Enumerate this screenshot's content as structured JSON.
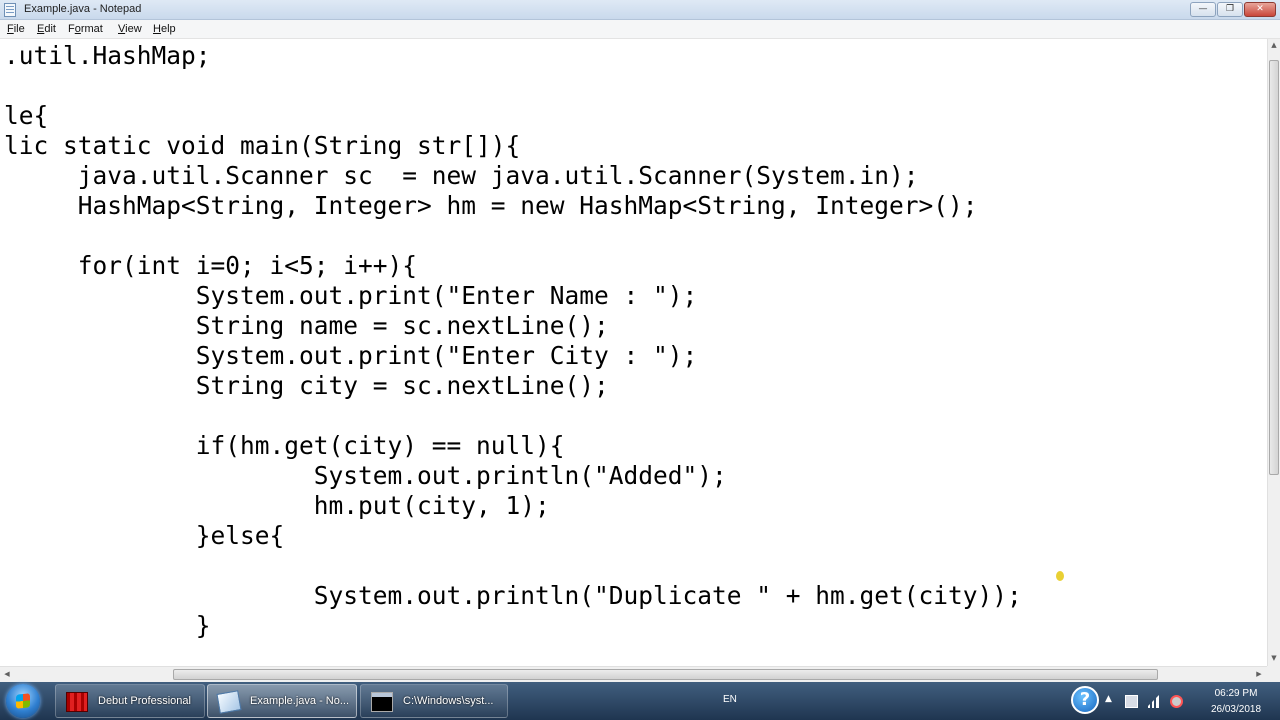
{
  "window": {
    "title": "Example.java - Notepad",
    "controls": {
      "minimize": "—",
      "maximize": "❐",
      "close": "✕"
    }
  },
  "menu": [
    {
      "label": "File",
      "access": "F",
      "rest": "ile"
    },
    {
      "label": "Edit",
      "access": "E",
      "rest": "dit"
    },
    {
      "label": "Format",
      "access": "o",
      "prefix": "F",
      "rest": "rmat"
    },
    {
      "label": "View",
      "access": "V",
      "rest": "iew"
    },
    {
      "label": "Help",
      "access": "H",
      "rest": "elp"
    }
  ],
  "editor": {
    "lines": [
      ".util.HashMap;",
      "",
      "le{",
      "lic static void main(String str[]){",
      "     java.util.Scanner sc  = new java.util.Scanner(System.in);",
      "     HashMap<String, Integer> hm = new HashMap<String, Integer>();",
      "",
      "     for(int i=0; i<5; i++){",
      "             System.out.print(\"Enter Name : \");",
      "             String name = sc.nextLine();",
      "             System.out.print(\"Enter City : \");",
      "             String city = sc.nextLine();",
      "",
      "             if(hm.get(city) == null){",
      "                     System.out.println(\"Added\");",
      "                     hm.put(city, 1);",
      "             }else{",
      "",
      "                     System.out.println(\"Duplicate \" + hm.get(city));",
      "             }"
    ]
  },
  "taskbar": {
    "items": [
      {
        "label": "Debut Professional",
        "icon": "debut-icon"
      },
      {
        "label": "Example.java - No...",
        "icon": "notepad-icon",
        "active": true
      },
      {
        "label": "C:\\Windows\\syst...",
        "icon": "cmd-icon"
      }
    ],
    "language": "EN",
    "help_glyph": "?",
    "clock": {
      "time": "06:29 PM",
      "date": "26/03/2018"
    }
  }
}
